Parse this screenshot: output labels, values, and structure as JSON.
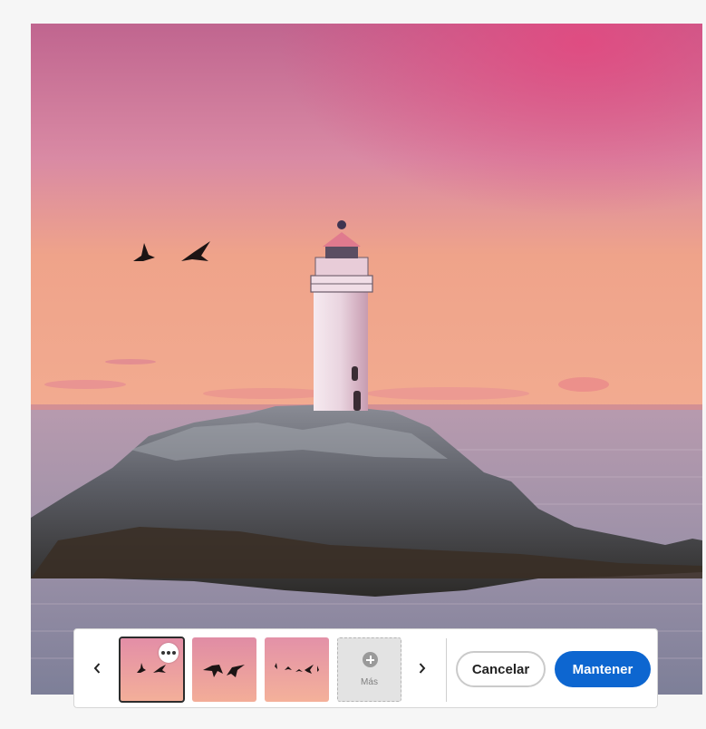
{
  "canvas": {
    "image_name": "lighthouse-sunset-image",
    "colors": {
      "sky_top": "#c56a9a",
      "sky_horizon": "#f1a27f",
      "sea": "#8e8ea5"
    }
  },
  "variations": {
    "items": [
      {
        "name": "variation-1",
        "selected": true
      },
      {
        "name": "variation-2",
        "selected": false
      },
      {
        "name": "variation-3",
        "selected": false
      }
    ],
    "more_label": "Más"
  },
  "actions": {
    "cancel_label": "Cancelar",
    "keep_label": "Mantener",
    "accent_color": "#0d66d0"
  },
  "icons": {
    "prev": "chevron-left-icon",
    "next": "chevron-right-icon",
    "more_options": "ellipsis-icon",
    "add": "plus-circle-icon"
  }
}
